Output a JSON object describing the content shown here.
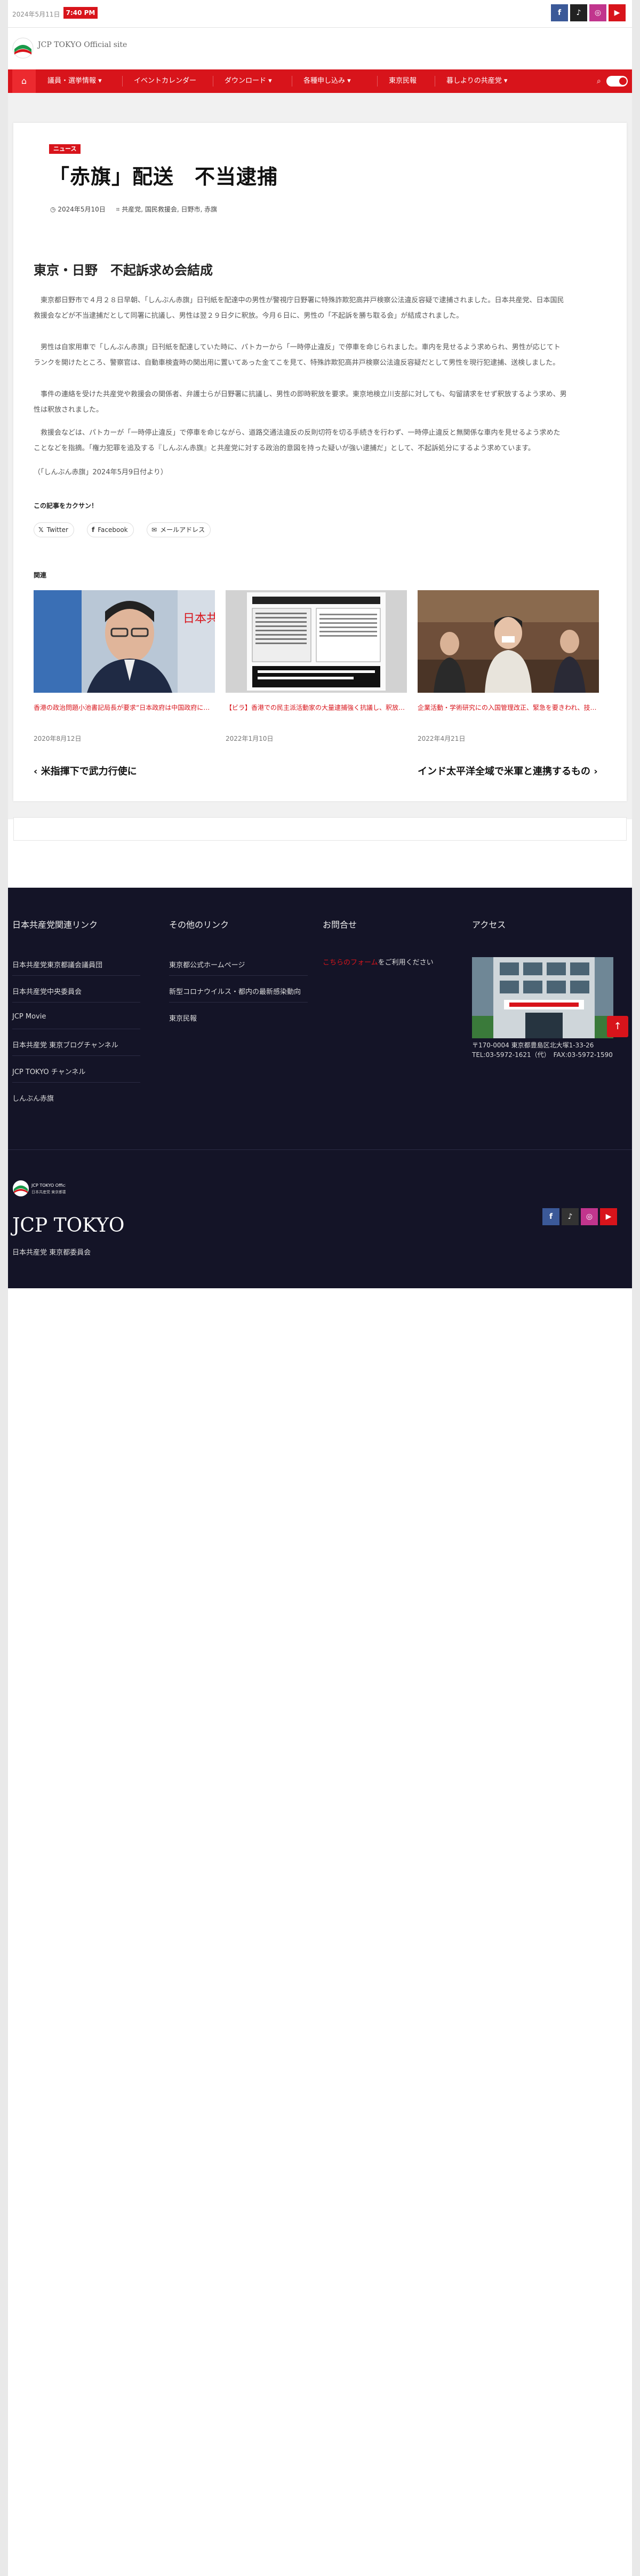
{
  "topbar": {
    "date": "2024年5月11日",
    "time": "7:40 PM",
    "social": [
      {
        "icon": "facebook-icon",
        "glyph": "f",
        "color": "#3b5998"
      },
      {
        "icon": "tiktok-icon",
        "glyph": "♪",
        "color": "#222222"
      },
      {
        "icon": "instagram-icon",
        "glyph": "◎",
        "color": "#c1358d"
      },
      {
        "icon": "youtube-icon",
        "glyph": "▶",
        "color": "#d8141b"
      }
    ]
  },
  "header": {
    "site_title": "JCP TOKYO Official site"
  },
  "nav": {
    "home_glyph": "⌂",
    "items": [
      {
        "label": "議員・選挙情報",
        "dropdown": true
      },
      {
        "label": "イベントカレンダー",
        "dropdown": false
      },
      {
        "label": "ダウンロード",
        "dropdown": true
      },
      {
        "label": "各種申し込み",
        "dropdown": true
      },
      {
        "label": "東京民報",
        "dropdown": false
      },
      {
        "label": "暮しよりの共産党",
        "dropdown": true
      }
    ],
    "search_glyph": "⌕"
  },
  "article": {
    "badge": "ニュース",
    "title": "「赤旗」配送　不当逮捕",
    "date": "2024年5月10日",
    "tags": "共産党, 国民救援会, 日野市, 赤旗",
    "subhead": "東京・日野　不起訴求め会結成",
    "paragraphs": [
      "東京都日野市で４月２８日早朝、「しんぶん赤旗」日刊紙を配達中の男性が警視庁日野署に特殊詐欺犯高井戸検察公法違反容疑で逮捕されました。日本共産党、日本国民救援会などが不当逮捕だとして同署に抗議し、男性は翌２９日夕に釈放。今月６日に、男性の「不起訴を勝ち取る会」が結成されました。",
      "男性は自家用車で「しんぶん赤旗」日刊紙を配達していた時に、パトカーから「一時停止違反」で停車を命じられました。車内を見せるよう求められ、男性が応じてトランクを開けたところ、警察官は、自動車検査時の関出用に置いてあった金てこを見て、特殊詐欺犯高井戸検察公法違反容疑だとして男性を現行犯逮捕、送検しました。",
      "事件の連絡を受けた共産党や救援会の関係者、弁護士らが日野署に抗議し、男性の即時釈放を要求。東京地検立川支部に対しても、勾留請求をせず釈放するよう求め、男性は釈放されました。",
      "救援会などは、パトカーが「一時停止違反」で停車を命じながら、道路交通法違反の反則切符を切る手続きを行わず、一時停止違反と無関係な車内を見せるよう求めたことなどを指摘。「権力犯罪を追及する『しんぶん赤旗』と共産党に対する政治的意図を持った疑いが強い逮捕だ」として、不起訴処分にするよう求めています。",
      "（「しんぶん赤旗」2024年5月9日付より）"
    ],
    "share_heading": "この記事をカクサン！",
    "share_buttons": [
      {
        "icon": "twitter-icon",
        "glyph": "𝕏",
        "label": "Twitter"
      },
      {
        "icon": "facebook-icon",
        "glyph": "f",
        "label": "Facebook"
      },
      {
        "icon": "email-icon",
        "glyph": "✉",
        "label": "メールアドレス"
      }
    ],
    "related_heading": "関連",
    "related": [
      {
        "title": "香港の政治問題小池書記局長が要求“日本政府は中国政府に抗議し、弾圧中止求めよ”",
        "date": "2020年8月12日"
      },
      {
        "title": "【ビラ】香港での民主派活動家の大量逮捕強く抗議し、釈放を求める／日本共産党・志位委員長が声明",
        "date": "2022年1月10日"
      },
      {
        "title": "企業活動・学術研究にの入国管理改正、緊急を要きわれ、技術優位保護と国家間行為",
        "date": "2022年4月21日"
      }
    ],
    "prev_post": "米指揮下で武力行使に",
    "next_post": "インド太平洋全域で米軍と連携するもの"
  },
  "footer": {
    "col1_heading": "日本共産党関連リンク",
    "col1_links": [
      "日本共産党東京都議会議員団",
      "日本共産党中央委員会",
      "JCP Movie",
      "日本共産党 東京ブログチャンネル",
      "JCP TOKYO チャンネル",
      "しんぶん赤旗"
    ],
    "col2_heading": "その他のリンク",
    "col2_links": [
      "東京都公式ホームページ",
      "新型コロナウイルス・都内の最新感染動向",
      "東京民報"
    ],
    "col3_heading": "お問合せ",
    "contact_link": "こちらのフォーム",
    "contact_text": "をご利用ください",
    "col4_heading": "アクセス",
    "address": "〒170-0004 東京都豊島区北大塚1-33-26",
    "tel": "TEL:03-5972-1621（代）　FAX:03-5972-1590",
    "brand_big": "JCP TOKYO",
    "brand_sub": "日本共産党 東京都委員会",
    "logo_text": "JCP TOKYO Official site",
    "logo_sub": "日本共産党 東京都委員会",
    "back_to_top": "↑"
  }
}
